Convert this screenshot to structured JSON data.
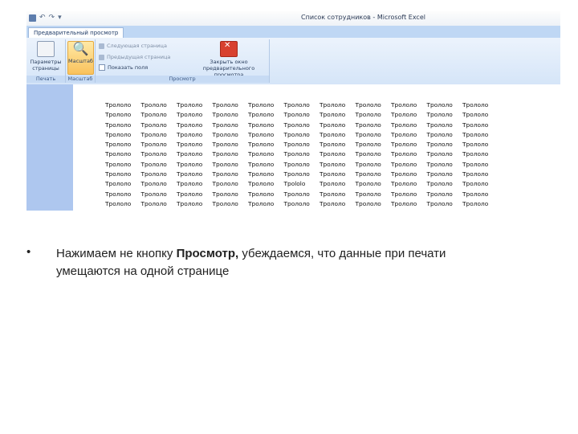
{
  "window": {
    "title": "Список сотрудников - Microsoft Excel"
  },
  "quick_access": {
    "save_icon": "save-icon",
    "undo": "↶",
    "redo": "↷",
    "dropdown": "▾"
  },
  "ribbon": {
    "active_tab": "Предварительный просмотр",
    "groups": {
      "print": {
        "label": "Печать",
        "buttons": {
          "page_setup": "Параметры страницы"
        }
      },
      "zoom": {
        "label": "Масштаб",
        "buttons": {
          "zoom": "Масштаб"
        }
      },
      "preview": {
        "label": "Просмотр",
        "buttons": {
          "next_page": "Следующая страница",
          "prev_page": "Предыдущая страница",
          "show_margins": "Показать поля",
          "close_preview": "Закрыть окно предварительного просмотра"
        }
      }
    }
  },
  "sheet": {
    "cell_text": "Трололо",
    "rows": [
      [
        "Трололо",
        "Трололо",
        "Трололо",
        "Трололо",
        "Трололо",
        "Трололо",
        "Трололо",
        "Трололо",
        "Трололо",
        "Трололо",
        "Трололо"
      ],
      [
        "Трололо",
        "Трололо",
        "Трололо",
        "Трололо",
        "Трололо",
        "Трололо",
        "Трололо",
        "Трололо",
        "Трололо",
        "Трололо",
        "Трололо"
      ],
      [
        "Трололо",
        "Трололо",
        "Трололо",
        "Трололо",
        "Трололо",
        "Трололо",
        "Трололо",
        "Трололо",
        "Трололо",
        "Трололо",
        "Трололо"
      ],
      [
        "Трололо",
        "Трололо",
        "Трололо",
        "Трололо",
        "Трололо",
        "Трололо",
        "Трололо",
        "Трололо",
        "Трололо",
        "Трололо",
        "Трололо"
      ],
      [
        "Трололо",
        "Трололо",
        "Трололо",
        "Трололо",
        "Трололо",
        "Трололо",
        "Трололо",
        "Трололо",
        "Трололо",
        "Трололо",
        "Трололо"
      ],
      [
        "Трололо",
        "Трололо",
        "Трололо",
        "Трололо",
        "Трололо",
        "Трололо",
        "Трололо",
        "Трололо",
        "Трололо",
        "Трололо",
        "Трололо"
      ],
      [
        "Трололо",
        "Трололо",
        "Трололо",
        "Трололо",
        "Трололо",
        "Трололо",
        "Трололо",
        "Трололо",
        "Трололо",
        "Трололо",
        "Трололо"
      ],
      [
        "Трололо",
        "Трололо",
        "Трололо",
        "Трололо",
        "Трололо",
        "Трололо",
        "Трололо",
        "Трололо",
        "Трололо",
        "Трололо",
        "Трололо"
      ],
      [
        "Трололо",
        "Трололо",
        "Трололо",
        "Трололо",
        "Трололо",
        "Трololo",
        "Трололо",
        "Трололо",
        "Трололо",
        "Трололо",
        "Трололо"
      ],
      [
        "Трололо",
        "Трололо",
        "Трололо",
        "Трололо",
        "Трололо",
        "Трололо",
        "Трололо",
        "Трололо",
        "Трололо",
        "Трололо",
        "Трололо"
      ],
      [
        "Трололо",
        "Трололо",
        "Трололо",
        "Трололо",
        "Трололо",
        "Трололо",
        "Трололо",
        "Трололо",
        "Трололо",
        "Трололо",
        "Трололо"
      ]
    ]
  },
  "caption": {
    "bullet": "•",
    "before": "Нажимаем не кнопку ",
    "bold": "Просмотр,",
    "after": " убеждаемся, что данные при печати умещаются на одной странице"
  },
  "colors": {
    "ribbon_bg": "#d5e5f8",
    "tab_row": "#bfd7f4",
    "zoom_active": "#f9c25c",
    "left_strip": "#aec7ef"
  }
}
